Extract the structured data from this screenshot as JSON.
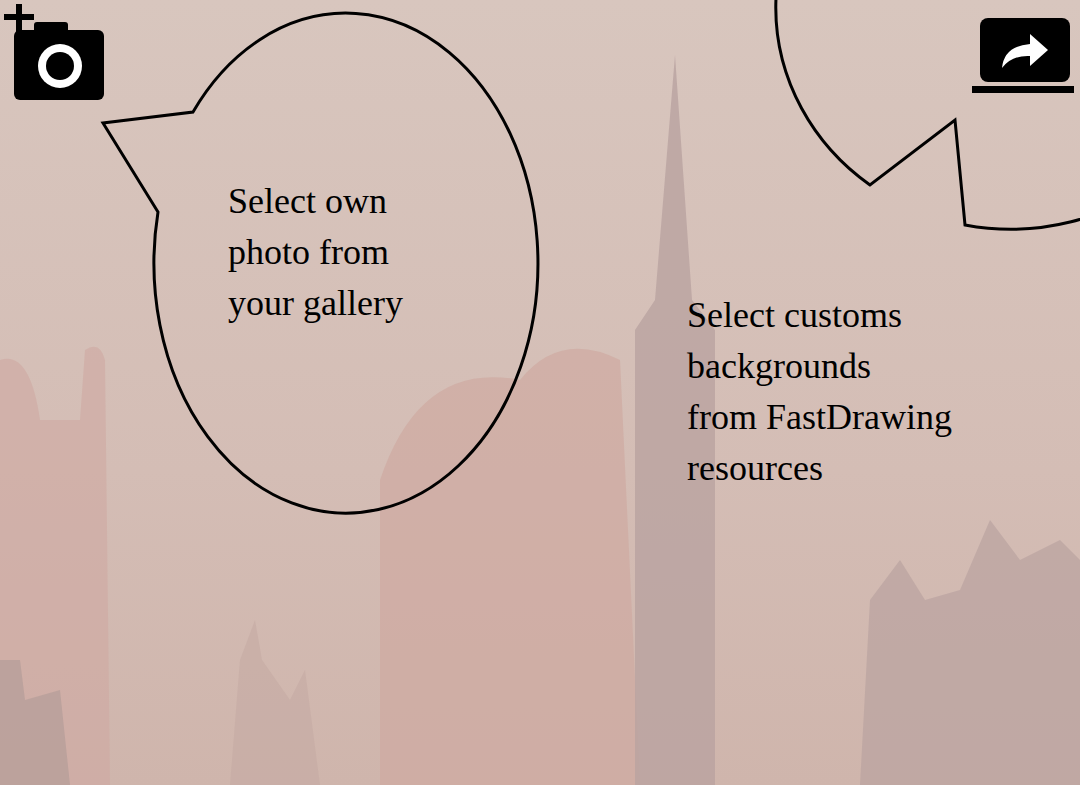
{
  "callouts": [
    {
      "target": "add-photo",
      "lines": [
        "Select own",
        "photo from",
        "your gallery"
      ]
    },
    {
      "target": "backgrounds",
      "lines": [
        "Select customs",
        "backgrounds",
        "from FastDrawing",
        "resources"
      ]
    }
  ]
}
